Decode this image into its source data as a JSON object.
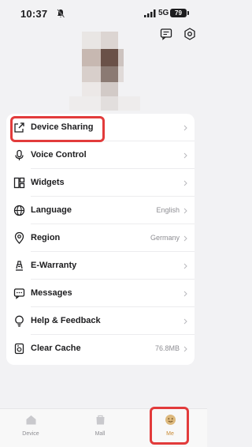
{
  "status_bar": {
    "time": "10:37",
    "network": "5G",
    "battery": "79"
  },
  "header": {
    "icons": [
      "chat-icon",
      "settings-icon"
    ]
  },
  "menu": {
    "items": [
      {
        "label": "Device Sharing",
        "value": "",
        "icon": "share-icon"
      },
      {
        "label": "Voice Control",
        "value": "",
        "icon": "microphone-icon"
      },
      {
        "label": "Widgets",
        "value": "",
        "icon": "widgets-icon"
      },
      {
        "label": "Language",
        "value": "English",
        "icon": "globe-icon"
      },
      {
        "label": "Region",
        "value": "Germany",
        "icon": "location-pin-icon"
      },
      {
        "label": "E-Warranty",
        "value": "",
        "icon": "warranty-icon"
      },
      {
        "label": "Messages",
        "value": "",
        "icon": "message-icon"
      },
      {
        "label": "Help & Feedback",
        "value": "",
        "icon": "lightbulb-icon"
      },
      {
        "label": "Clear Cache",
        "value": "76.8MB",
        "icon": "clear-cache-icon"
      }
    ]
  },
  "tab_bar": {
    "tabs": [
      {
        "label": "Device",
        "active": false
      },
      {
        "label": "Mall",
        "active": false
      },
      {
        "label": "Me",
        "active": true
      }
    ]
  },
  "colors": {
    "accent": "#e23b3b",
    "active_tab": "#c98a33",
    "background": "#f2f2f4"
  }
}
